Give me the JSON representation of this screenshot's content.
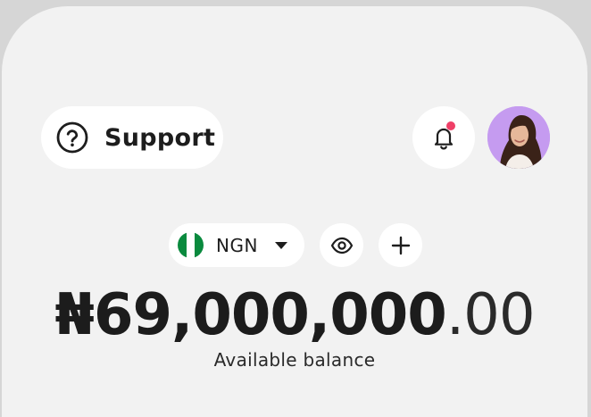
{
  "header": {
    "support_label": "Support",
    "has_unread_notifications": true
  },
  "wallet": {
    "currency_code": "NGN",
    "balance_main": "₦69,000,000",
    "balance_decimal": ".00",
    "balance_label": "Available balance"
  },
  "colors": {
    "background": "#f2f2f2",
    "avatar_bg": "#c59bf0",
    "notification_dot": "#ef3f67",
    "flag_green": "#0a8a3e"
  },
  "icons": {
    "support": "question-circle-icon",
    "notifications": "bell-icon",
    "currency_dropdown": "caret-down-icon",
    "toggle_visibility": "eye-icon",
    "add_funds": "plus-icon"
  }
}
